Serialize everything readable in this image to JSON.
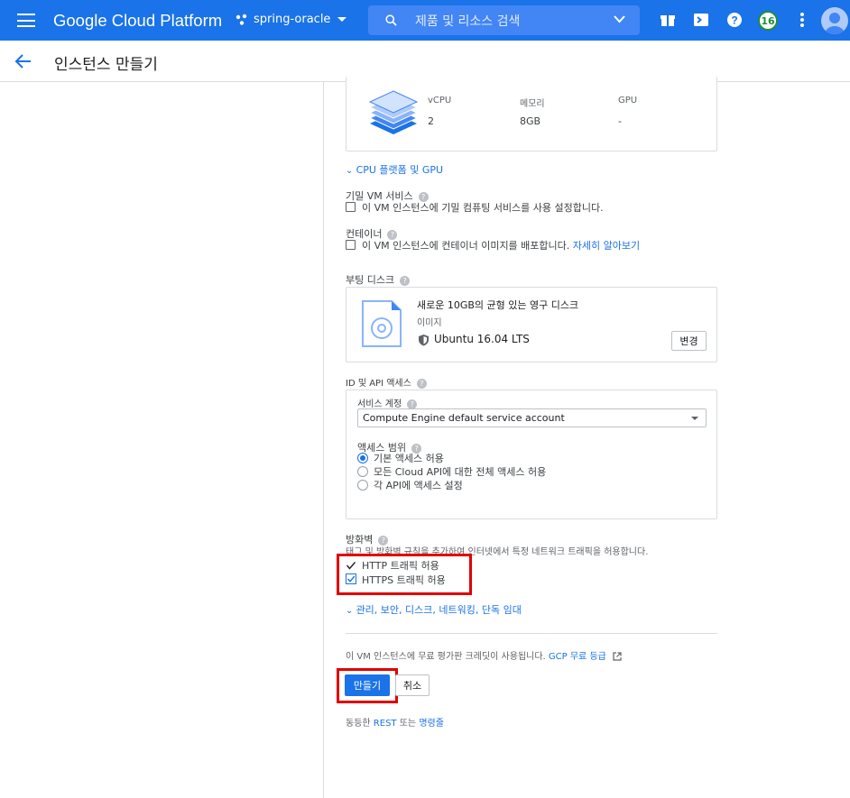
{
  "header": {
    "brand": "Google Cloud Platform",
    "project": "spring-oracle",
    "search_placeholder": "제품 및 리소스 검색",
    "notification_count": "16"
  },
  "page": {
    "title": "인스턴스 만들기"
  },
  "machine": {
    "cols": [
      {
        "label": "vCPU",
        "value": "2"
      },
      {
        "label": "메모리",
        "value": "8GB"
      },
      {
        "label": "GPU",
        "value": "-"
      }
    ],
    "cpu_platform_link": "CPU 플랫폼 및 GPU"
  },
  "confidential": {
    "label": "기밀 VM 서비스",
    "checkbox_label": "이 VM 인스턴스에 기밀 컴퓨팅 서비스를 사용 설정합니다."
  },
  "container": {
    "label": "컨테이너",
    "checkbox_label": "이 VM 인스턴스에 컨테이너 이미지를 배포합니다.",
    "learn_more": "자세히 알아보기"
  },
  "boot_disk": {
    "label": "부팅 디스크",
    "title": "새로운 10GB의 균형 있는 영구 디스크",
    "image_label": "이미지",
    "image_name": "Ubuntu 16.04 LTS",
    "change_button": "변경"
  },
  "identity": {
    "label": "ID 및 API 액세스",
    "service_account_label": "서비스 계정",
    "service_account_value": "Compute Engine default service account",
    "access_scope_label": "액세스 범위",
    "scopes": [
      {
        "label": "기본 액세스 허용",
        "selected": true
      },
      {
        "label": "모든 Cloud API에 대한 전체 액세스 허용",
        "selected": false
      },
      {
        "label": "각 API에 액세스 설정",
        "selected": false
      }
    ]
  },
  "firewall": {
    "label": "방화벽",
    "description": "태그 및 방화벽 규칙을 추가하여 인터넷에서 특정 네트워크 트래픽을 허용합니다.",
    "http_label": "HTTP 트래픽 허용",
    "https_label": "HTTPS 트래픽 허용",
    "http_checked": true,
    "https_checked": true
  },
  "advanced_link": "관리, 보안, 디스크, 네트워킹, 단독 임대",
  "credit": {
    "text": "이 VM 인스턴스에 무료 평가판 크레딧이 사용됩니다.",
    "link": "GCP 무료 등급"
  },
  "actions": {
    "create": "만들기",
    "cancel": "취소"
  },
  "equivalent": {
    "prefix": "동등한",
    "rest": "REST",
    "middle": "또는",
    "cli": "명령줄"
  },
  "colors": {
    "primary": "#1a73e8",
    "highlight": "#e00000"
  }
}
